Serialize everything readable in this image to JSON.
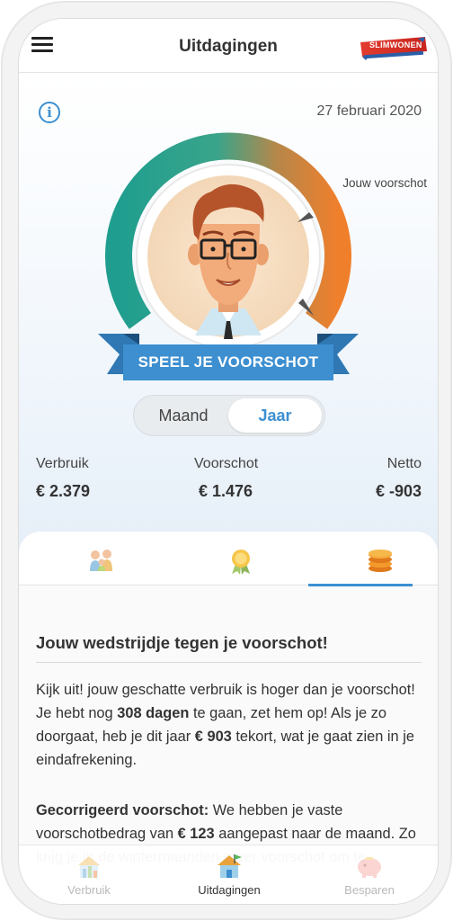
{
  "header": {
    "title": "Uitdagingen",
    "logo_text": "SLIMWONEN"
  },
  "top": {
    "date": "27 februari 2020",
    "gauge_label": "Jouw voorschot",
    "banner": "SPEEL JE VOORSCHOT",
    "toggle": {
      "options": [
        "Maand",
        "Jaar"
      ],
      "selected": "Jaar"
    },
    "stats": [
      {
        "label": "Verbruik",
        "value": "€ 2.379"
      },
      {
        "label": "Voorschot",
        "value": "€ 1.476"
      },
      {
        "label": "Netto",
        "value": "€ -903"
      }
    ]
  },
  "tabs": {
    "icons": [
      "family-icon",
      "medal-icon",
      "coins-icon"
    ],
    "active_index": 2
  },
  "content": {
    "title": "Jouw wedstrijdje tegen je voorschot!",
    "p1": {
      "a": "Kijk uit! jouw geschatte verbruik is hoger dan je voorschot! Je hebt nog ",
      "days": "308 dagen",
      "b": " te gaan, zet hem op! Als je zo doorgaat, heb je dit jaar ",
      "amount": "€ 903",
      "c": " tekort, wat je gaat zien in je eindafrekening."
    },
    "p2": {
      "lead": "Gecorrigeerd voorschot:",
      "a": " We hebben je vaste voorschotbedrag van ",
      "amount": "€ 123",
      "b": " aangepast naar de maand. Zo krijg je in de wintermaanden meer voorschot om te"
    }
  },
  "bottom_nav": {
    "items": [
      {
        "label": "Verbruik",
        "icon": "chart-house-icon"
      },
      {
        "label": "Uitdagingen",
        "icon": "house-flag-icon"
      },
      {
        "label": "Besparen",
        "icon": "piggy-bank-icon"
      }
    ],
    "active_index": 1
  },
  "colors": {
    "accent": "#3d8fd0",
    "gauge_start": "#1f9e8f",
    "gauge_end": "#f07f2c",
    "banner": "#3d8fd0"
  }
}
